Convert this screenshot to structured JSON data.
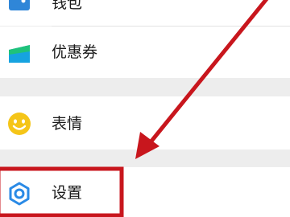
{
  "menu": {
    "items": [
      {
        "label": "钱包",
        "icon": "wallet-icon"
      },
      {
        "label": "优惠券",
        "icon": "coupon-icon"
      },
      {
        "label": "表情",
        "icon": "emoji-icon"
      },
      {
        "label": "设置",
        "icon": "gear-icon"
      }
    ]
  },
  "colors": {
    "wallet": "#2f86d8",
    "coupon": "#16a3e0",
    "emoji": "#f5c518",
    "settings": "#2a8ae6",
    "annotation": "#c8161d",
    "section_gap": "#ededed"
  },
  "annotation": {
    "type": "red arrow pointing to highlighted item",
    "highlighted_item": "设置"
  }
}
